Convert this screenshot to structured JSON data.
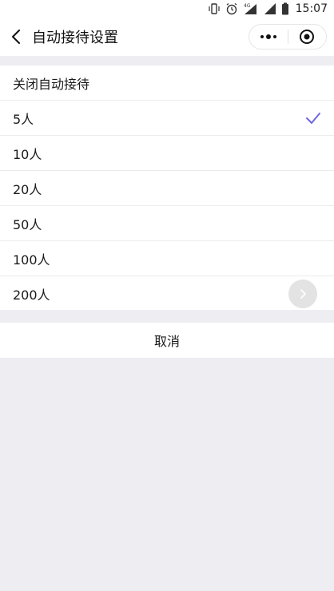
{
  "status_bar": {
    "network": "4G",
    "time": "15:07",
    "icons": [
      "vibrate-icon",
      "alarm-icon",
      "signal-icon",
      "signal-icon",
      "battery-icon"
    ]
  },
  "nav": {
    "title": "自动接待设置",
    "back_icon": "chevron-left-icon",
    "more_icon": "more-dots-icon",
    "close_icon": "target-circle-icon"
  },
  "options": [
    {
      "label": "关闭自动接待",
      "selected": false
    },
    {
      "label": "5人",
      "selected": true
    },
    {
      "label": "10人",
      "selected": false
    },
    {
      "label": "20人",
      "selected": false
    },
    {
      "label": "50人",
      "selected": false
    },
    {
      "label": "100人",
      "selected": false
    },
    {
      "label": "200人",
      "selected": false
    }
  ],
  "cancel_label": "取消",
  "colors": {
    "accent": "#6f67e0",
    "background": "#ededf2",
    "surface": "#ffffff",
    "float_button": "#e3e3e3"
  }
}
